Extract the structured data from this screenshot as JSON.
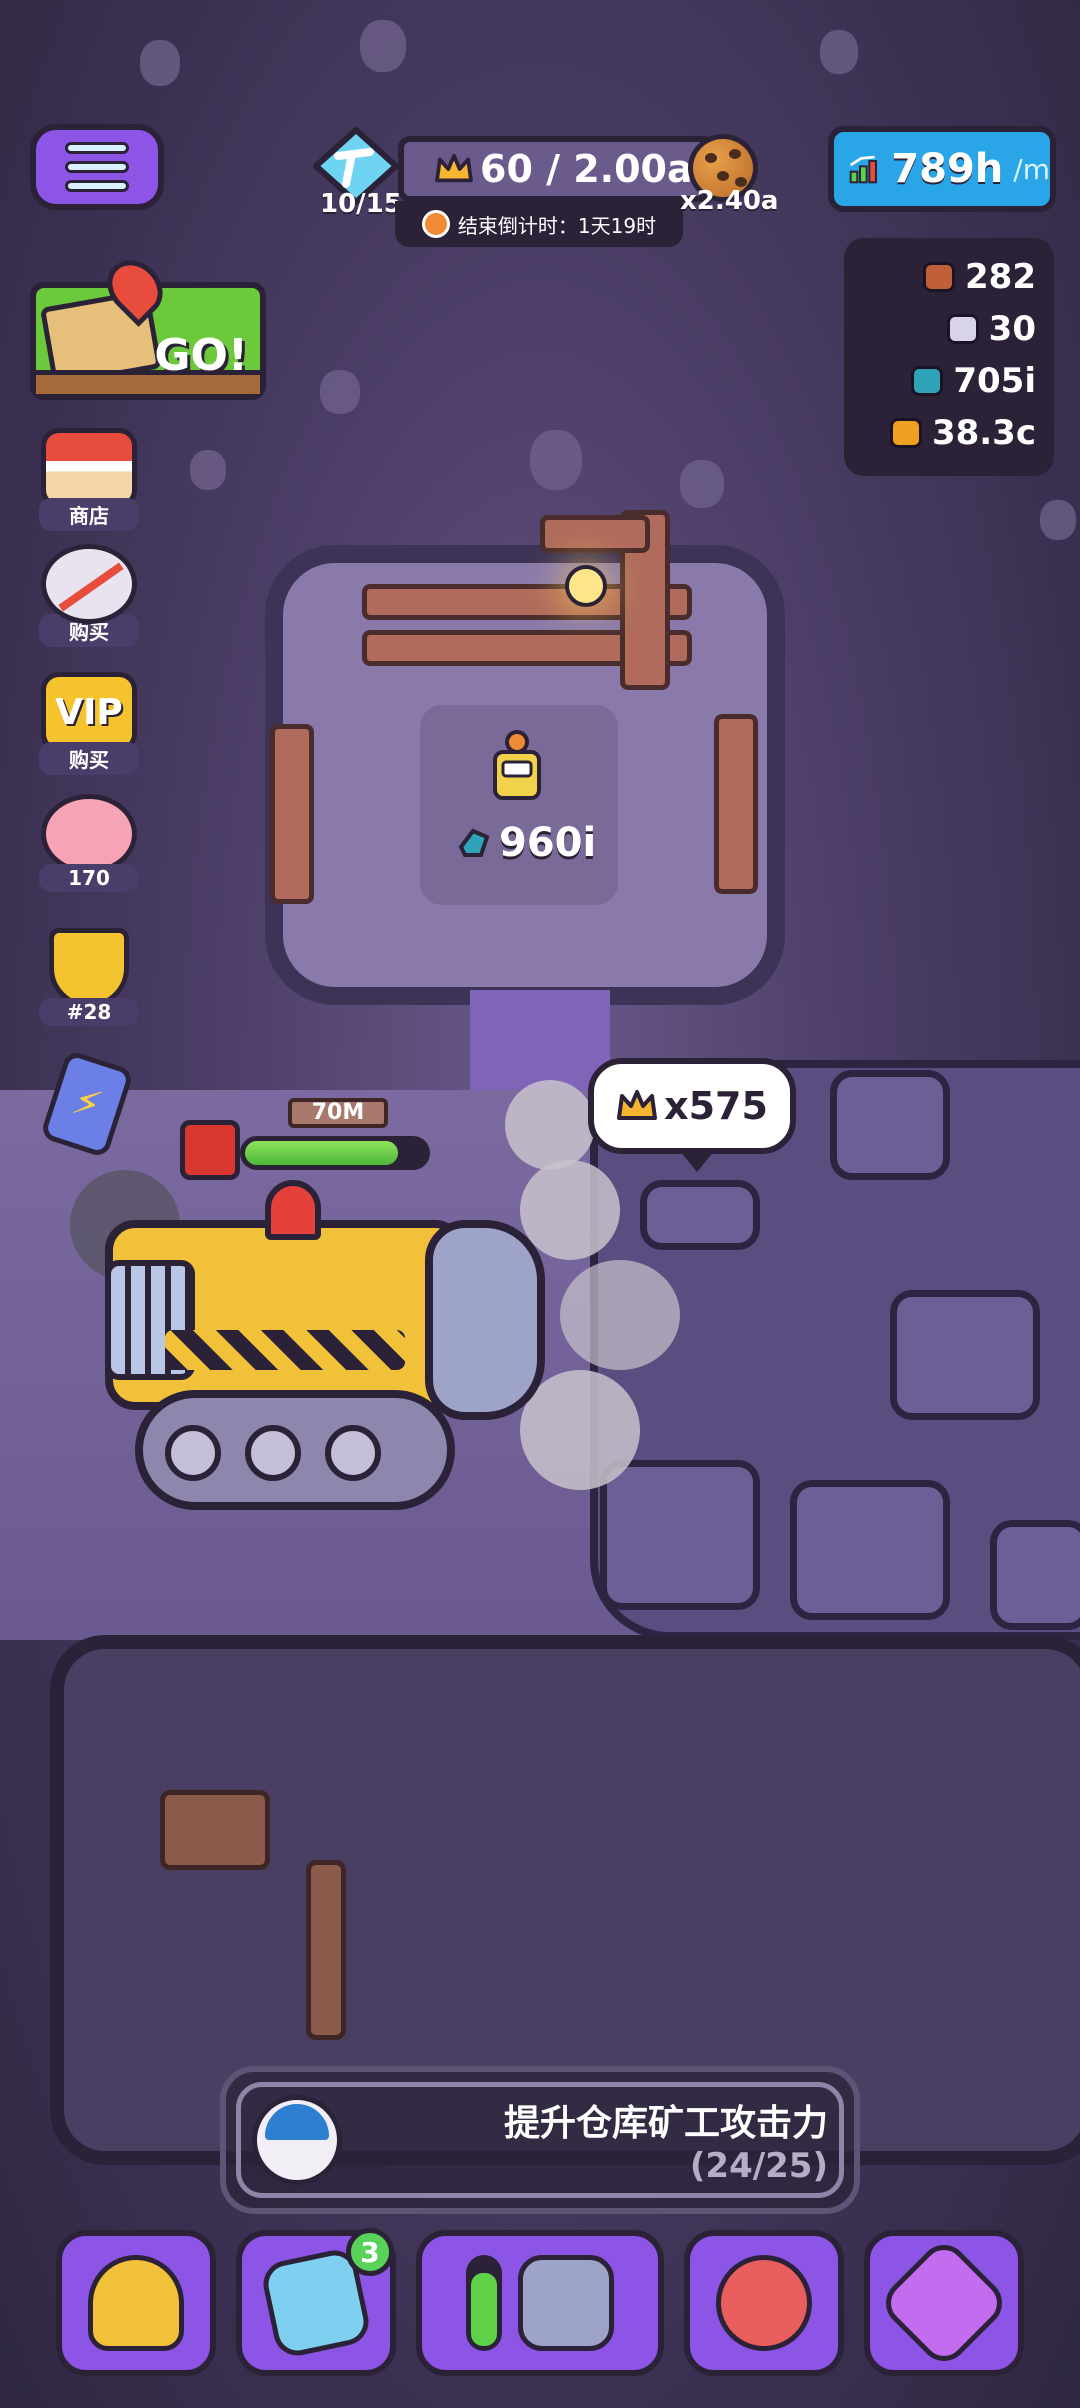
{
  "hud": {
    "menu_icon": "hamburger-menu-icon",
    "energy": {
      "value": "10/15",
      "icon": "pickaxe-gem-icon"
    },
    "crowns": {
      "value": "60 / 2.00a",
      "icon": "crown-icon"
    },
    "countdown": {
      "label": "结束倒计时：1天19时",
      "icon": "clock-icon"
    },
    "multiplier": {
      "value": "x2.40a",
      "icon": "cookie-icon"
    },
    "rate": {
      "value": "789h",
      "unit": "/m",
      "icon": "growth-chart-icon"
    }
  },
  "resources": [
    {
      "value": "282",
      "icon": "wood-ore-icon",
      "color": "#c0603a"
    },
    {
      "value": "30",
      "icon": "silver-ore-icon",
      "color": "#d9d3ea"
    },
    {
      "value": "705i",
      "icon": "teal-gem-icon",
      "color": "#2fa3b8"
    },
    {
      "value": "38.3c",
      "icon": "gold-nugget-icon",
      "color": "#f0a020"
    }
  ],
  "left_menu": {
    "go_button": {
      "label": "GO!",
      "icon": "map-pin-icon"
    },
    "shop": {
      "label": "商店"
    },
    "no_ads": {
      "label": "购买"
    },
    "vip": {
      "label": "购买",
      "badge_text": "VIP"
    },
    "piggy_bank": {
      "label": "170"
    },
    "ranking": {
      "label": "#28"
    }
  },
  "mine": {
    "depth_sign": "70M",
    "fuel_level": 0.85,
    "crown_reward": "x575",
    "room_value": "960i"
  },
  "quest": {
    "title": "提升仓库矿工攻击力",
    "progress": "(24/25)"
  },
  "bottom_nav": {
    "items": [
      {
        "name": "miners",
        "icon": "miner-helmet-icon"
      },
      {
        "name": "cards",
        "icon": "cards-icon",
        "badge": "3"
      },
      {
        "name": "drill",
        "icon": "drill-machine-icon"
      },
      {
        "name": "team",
        "icon": "miner-team-icon"
      },
      {
        "name": "forge",
        "icon": "hammer-gem-icon"
      }
    ]
  }
}
